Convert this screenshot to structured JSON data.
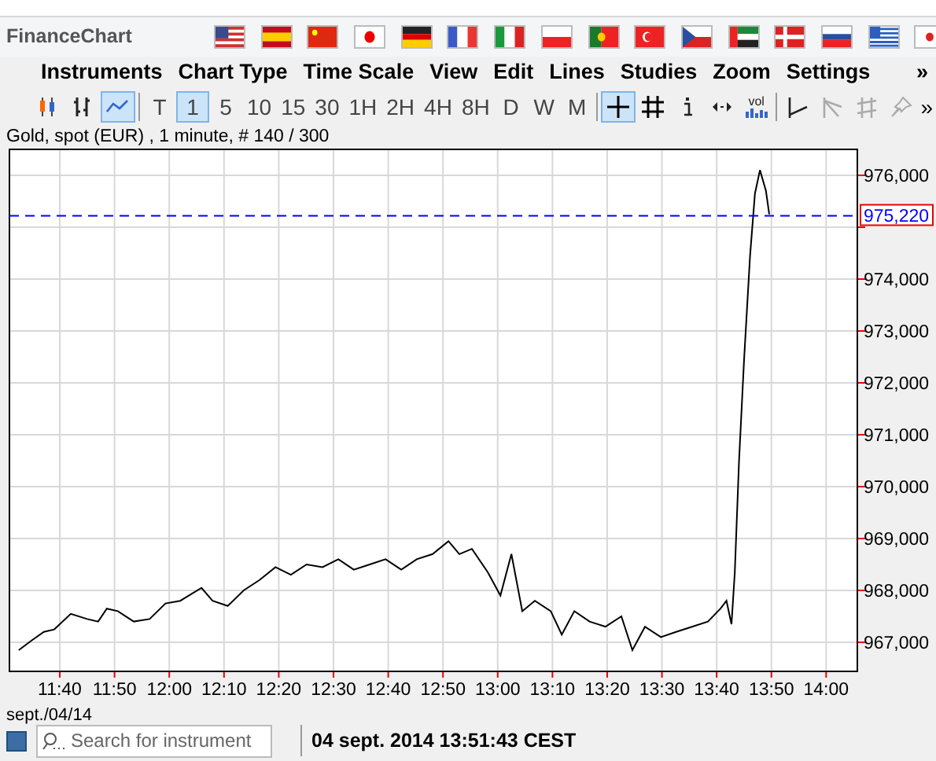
{
  "window": {
    "title": "FinanceChart"
  },
  "menu": [
    {
      "label": "Instruments"
    },
    {
      "label": "Chart Type"
    },
    {
      "label": "Time Scale"
    },
    {
      "label": "View"
    },
    {
      "label": "Edit"
    },
    {
      "label": "Lines"
    },
    {
      "label": "Studies"
    },
    {
      "label": "Zoom"
    },
    {
      "label": "Settings"
    }
  ],
  "menu_overflow": "»",
  "chart_type_buttons": [
    {
      "kind": "candlestick",
      "selected": false
    },
    {
      "kind": "ohlc",
      "selected": false
    },
    {
      "kind": "line",
      "selected": true
    }
  ],
  "time_scale_buttons": [
    {
      "label": "T",
      "selected": false
    },
    {
      "label": "1",
      "selected": true
    },
    {
      "label": "5",
      "selected": false
    },
    {
      "label": "10",
      "selected": false
    },
    {
      "label": "15",
      "selected": false
    },
    {
      "label": "30",
      "selected": false
    },
    {
      "label": "1H",
      "selected": false
    },
    {
      "label": "2H",
      "selected": false
    },
    {
      "label": "4H",
      "selected": false
    },
    {
      "label": "8H",
      "selected": false
    },
    {
      "label": "D",
      "selected": false
    },
    {
      "label": "W",
      "selected": false
    },
    {
      "label": "M",
      "selected": false
    }
  ],
  "view_buttons": [
    {
      "kind": "crosshair",
      "selected": true
    },
    {
      "kind": "grid",
      "selected": false
    },
    {
      "kind": "info",
      "selected": false
    },
    {
      "kind": "scroll",
      "selected": false
    },
    {
      "kind": "volume",
      "label": "vol",
      "selected": false
    }
  ],
  "drawing_tools": [
    {
      "kind": "trendline",
      "disabled": false
    },
    {
      "kind": "fan",
      "disabled": true
    },
    {
      "kind": "channel",
      "disabled": true
    },
    {
      "kind": "pin",
      "disabled": true
    }
  ],
  "toolbar_overflow": "»",
  "chart": {
    "subtitle": "Gold, spot (EUR) , 1 minute, # 140 / 300",
    "date_label": "sept./04/14",
    "chart_data": {
      "type": "line",
      "xlim": [
        690.8,
        845.7
      ],
      "ylim": [
        966440,
        976500
      ],
      "xticks": [
        {
          "value": 700,
          "label": "11:40"
        },
        {
          "value": 710,
          "label": "11:50"
        },
        {
          "value": 720,
          "label": "12:00"
        },
        {
          "value": 730,
          "label": "12:10"
        },
        {
          "value": 740,
          "label": "12:20"
        },
        {
          "value": 750,
          "label": "12:30"
        },
        {
          "value": 760,
          "label": "12:40"
        },
        {
          "value": 770,
          "label": "12:50"
        },
        {
          "value": 780,
          "label": "13:00"
        },
        {
          "value": 790,
          "label": "13:10"
        },
        {
          "value": 800,
          "label": "13:20"
        },
        {
          "value": 810,
          "label": "13:30"
        },
        {
          "value": 820,
          "label": "13:40"
        },
        {
          "value": 830,
          "label": "13:50"
        },
        {
          "value": 840,
          "label": "14:00"
        }
      ],
      "yticks": [
        {
          "value": 967000,
          "label": "967,000"
        },
        {
          "value": 968000,
          "label": "968,000"
        },
        {
          "value": 969000,
          "label": "969,000"
        },
        {
          "value": 970000,
          "label": "970,000"
        },
        {
          "value": 971000,
          "label": "971,000"
        },
        {
          "value": 972000,
          "label": "972,000"
        },
        {
          "value": 973000,
          "label": "973,000"
        },
        {
          "value": 974000,
          "label": "974,000"
        },
        {
          "value": 976000,
          "label": "976,000"
        }
      ],
      "x": [
        692.5,
        694.8,
        697.1,
        699,
        702,
        705,
        707,
        708.6,
        710.6,
        713.5,
        716.4,
        719.3,
        722,
        725.9,
        727.9,
        730.7,
        733.6,
        736.5,
        739.4,
        742.2,
        745.1,
        748,
        750.9,
        753.7,
        756.6,
        759.5,
        762.4,
        765.2,
        768.1,
        771,
        773,
        775.3,
        778.2,
        780.5,
        782.5,
        784.5,
        786.8,
        789.7,
        791.7,
        794,
        796.8,
        799.7,
        802.6,
        804.6,
        806.9,
        809.8,
        812.6,
        815.5,
        818.4,
        820.7,
        821.8,
        822.7,
        823.3,
        824.1,
        825,
        826.1,
        827,
        827.9,
        829,
        829.6
      ],
      "series": [
        {
          "color": "#000000",
          "values": [
            966850,
            967030,
            967200,
            967250,
            967550,
            967450,
            967400,
            967650,
            967600,
            967400,
            967450,
            967750,
            967800,
            968050,
            967800,
            967700,
            968000,
            968200,
            968450,
            968300,
            968500,
            968450,
            968600,
            968400,
            968500,
            968600,
            968400,
            968600,
            968700,
            968950,
            968700,
            968800,
            968350,
            967900,
            968700,
            967600,
            967800,
            967600,
            967150,
            967600,
            967400,
            967300,
            967500,
            966850,
            967300,
            967100,
            967200,
            967300,
            967400,
            967650,
            967800,
            967350,
            968350,
            970500,
            972450,
            974450,
            975650,
            976100,
            975700,
            975250
          ]
        }
      ],
      "grid": true,
      "ref_lines": [
        {
          "axis": "y",
          "value": 975220,
          "label": "975,220"
        }
      ]
    }
  },
  "status_bar": {
    "search": {
      "placeholder": "Search for instrument"
    },
    "datetime": "04 sept. 2014 13:51:43 CEST"
  }
}
